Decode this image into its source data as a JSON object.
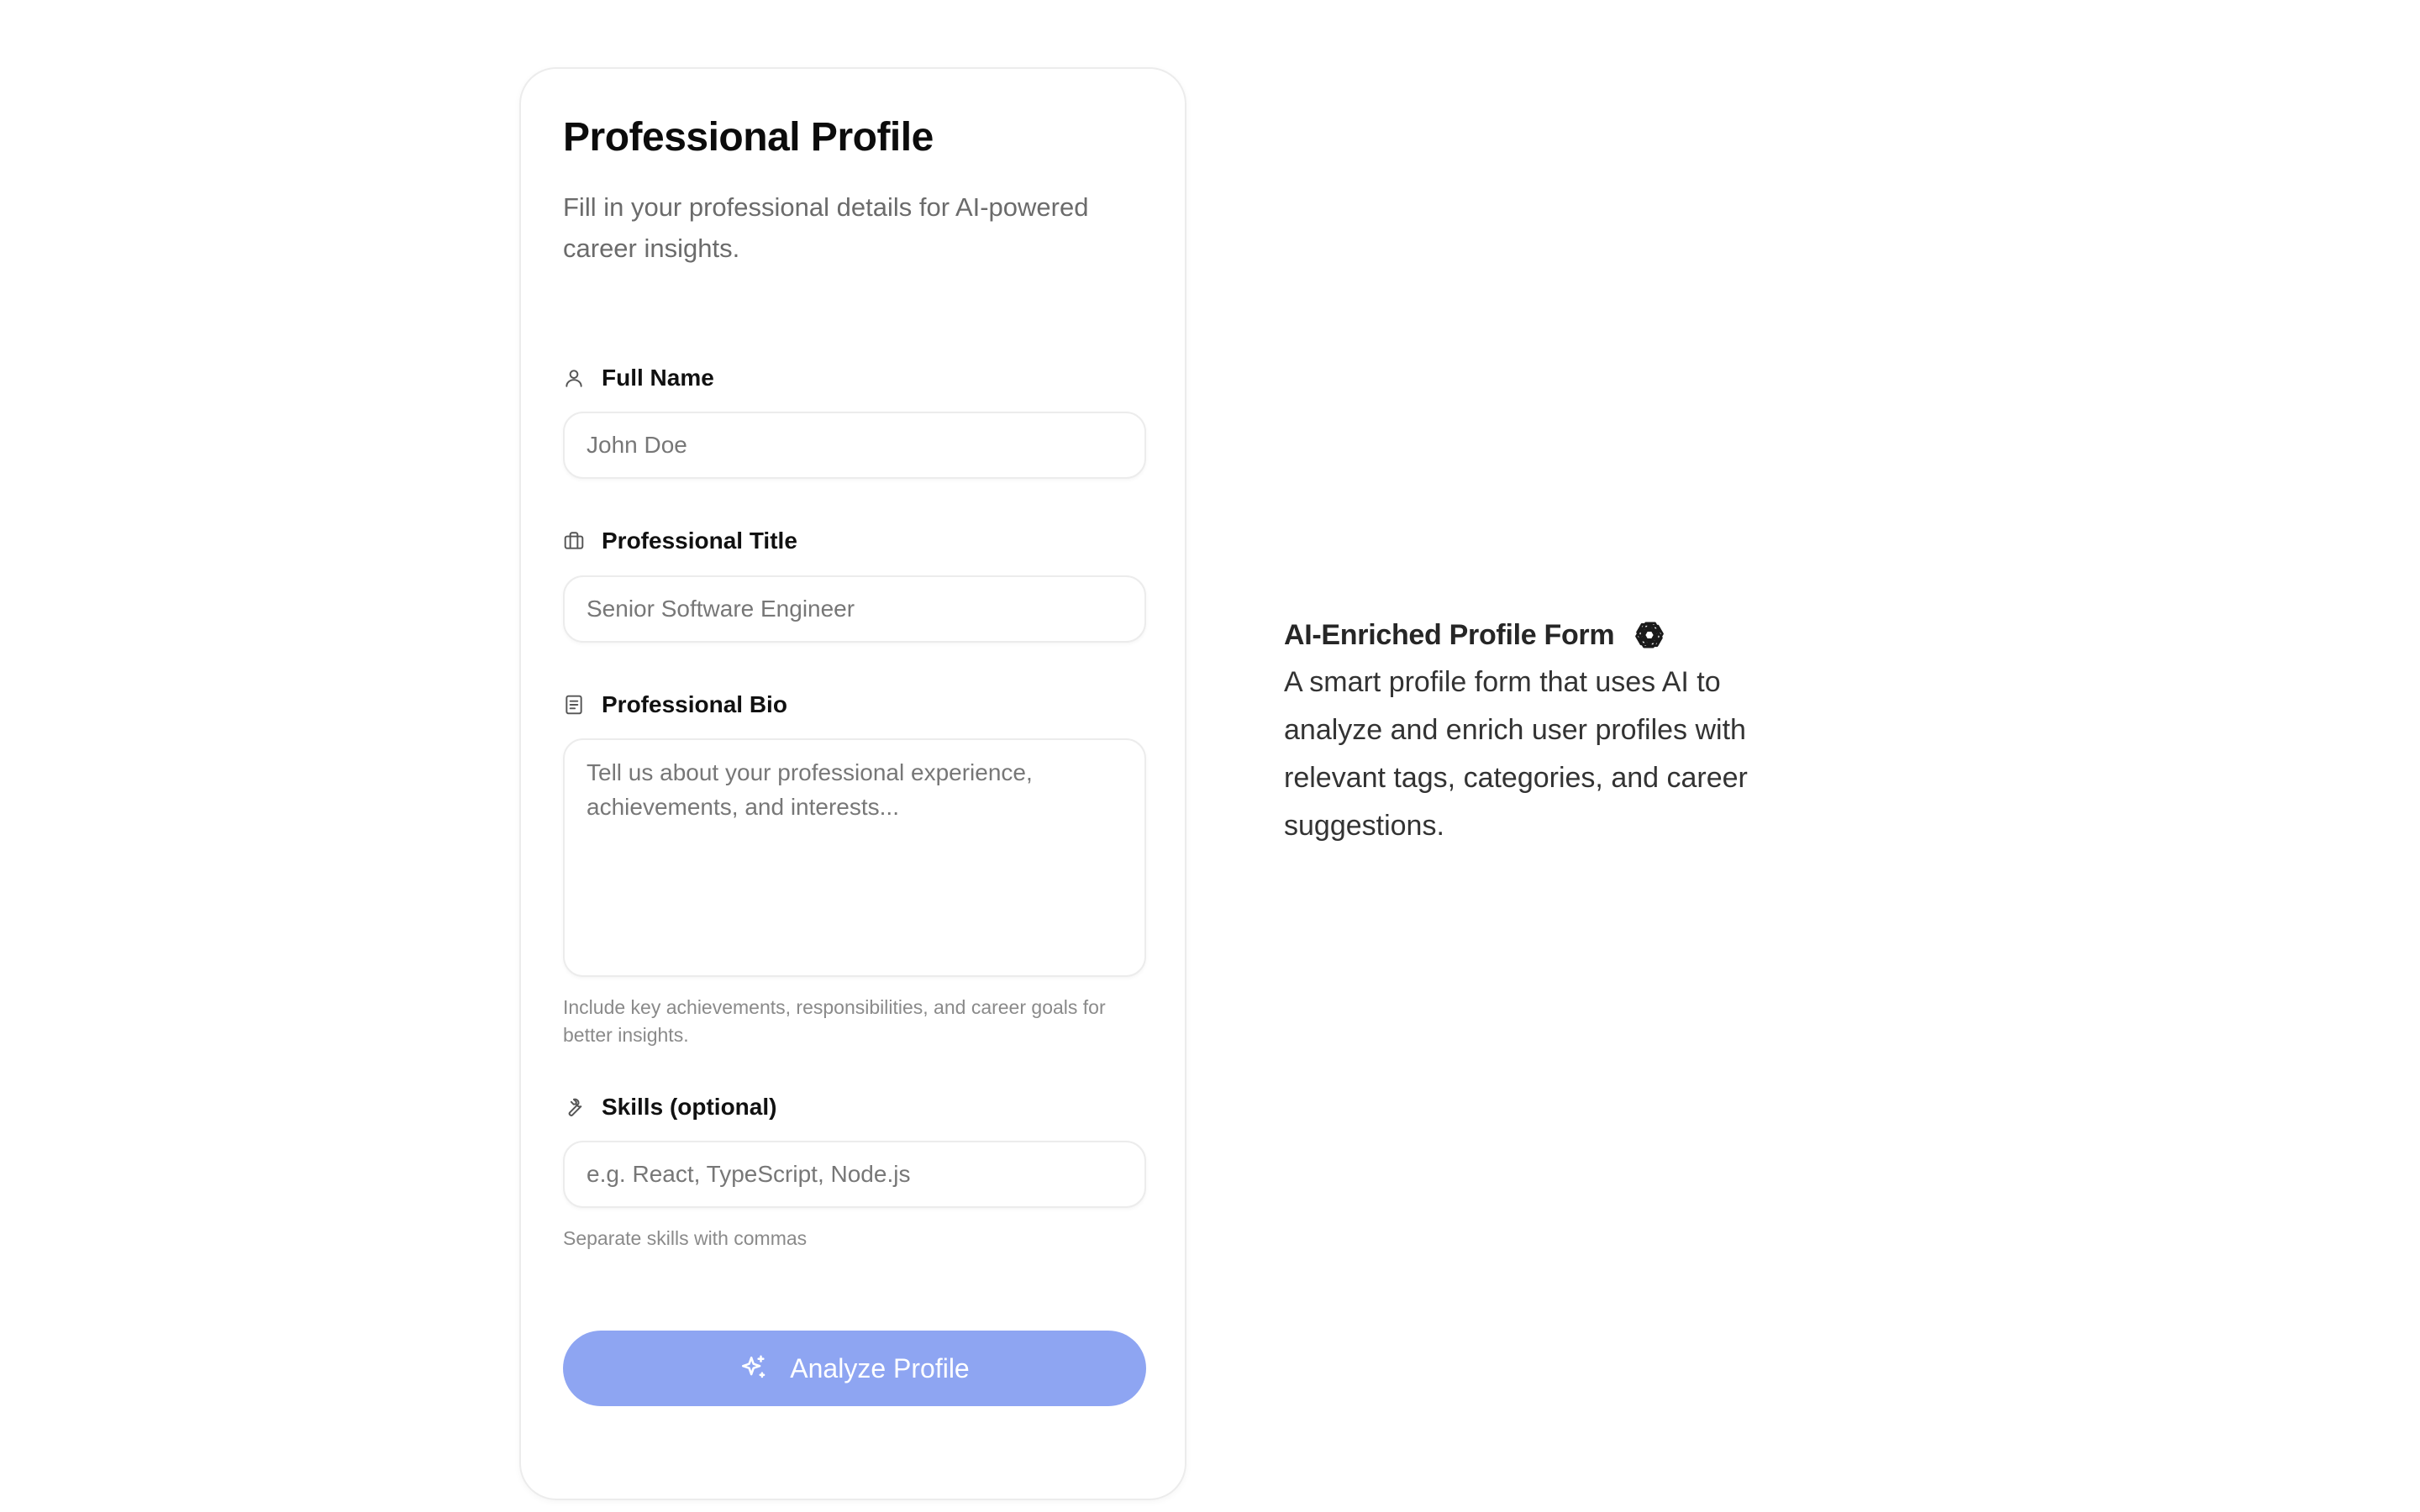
{
  "form": {
    "title": "Professional Profile",
    "subtitle": "Fill in your professional details for AI-powered career insights.",
    "fields": {
      "name": {
        "label": "Full Name",
        "placeholder": "John Doe",
        "icon": "user-icon"
      },
      "title": {
        "label": "Professional Title",
        "placeholder": "Senior Software Engineer",
        "icon": "briefcase-icon"
      },
      "bio": {
        "label": "Professional Bio",
        "placeholder": "Tell us about your professional experience, achievements, and interests...",
        "hint": "Include key achievements, responsibilities, and career goals for better insights.",
        "icon": "document-icon"
      },
      "skills": {
        "label": "Skills (optional)",
        "placeholder": "e.g. React, TypeScript, Node.js",
        "hint": "Separate skills with commas",
        "icon": "wrench-icon"
      }
    },
    "submit_label": "Analyze Profile",
    "submit_icon": "sparkles-icon",
    "submit_color": "#8ea5f2"
  },
  "sidebar": {
    "title": "AI-Enriched Profile Form",
    "title_icon": "openai-logo-icon",
    "description": "A smart profile form that uses AI to analyze and enrich user profiles with relevant tags, categories, and career suggestions."
  }
}
